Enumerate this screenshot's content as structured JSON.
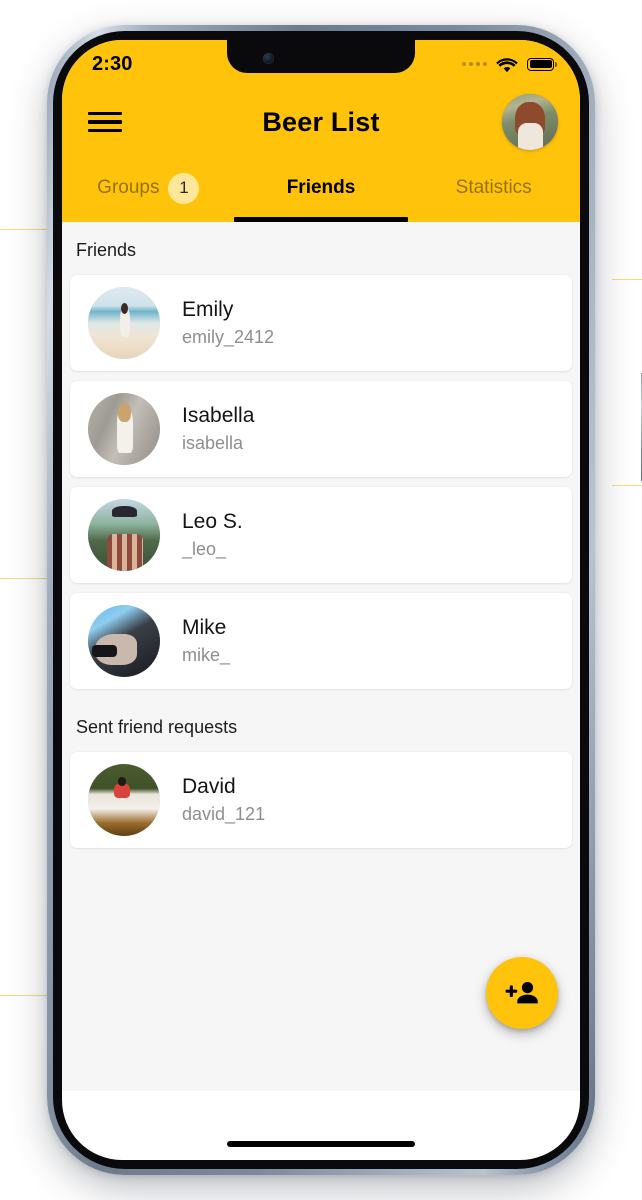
{
  "status_bar": {
    "time": "2:30",
    "cellular_icon": "cellular-dots-icon",
    "wifi_icon": "wifi-icon",
    "battery_icon": "battery-full-icon"
  },
  "header": {
    "menu_icon": "hamburger-menu-icon",
    "title": "Beer List",
    "avatar_icon": "profile-avatar",
    "background_color": "#FFC30B"
  },
  "tabs": [
    {
      "label": "Groups",
      "badge": "1",
      "active": false
    },
    {
      "label": "Friends",
      "badge": "",
      "active": true
    },
    {
      "label": "Statistics",
      "badge": "",
      "active": false
    }
  ],
  "sections": [
    {
      "title": "Friends",
      "items": [
        {
          "name": "Emily",
          "handle": "emily_2412",
          "avatar": "emily-avatar"
        },
        {
          "name": "Isabella",
          "handle": "isabella",
          "avatar": "isabella-avatar"
        },
        {
          "name": "Leo S.",
          "handle": "_leo_",
          "avatar": "leo-avatar"
        },
        {
          "name": "Mike",
          "handle": "mike_",
          "avatar": "mike-avatar"
        }
      ]
    },
    {
      "title": "Sent friend requests",
      "items": [
        {
          "name": "David",
          "handle": "david_121",
          "avatar": "david-avatar"
        }
      ]
    }
  ],
  "fab": {
    "icon": "person-add-icon",
    "color": "#FFC30B"
  },
  "colors": {
    "accent": "#FFC30B",
    "badge": "#FFE79A",
    "page_background": "#F6F6F6",
    "card_background": "#FFFFFF",
    "handle_text": "#8E8E8E",
    "inactive_tab_text": "rgba(0,0,0,0.42)"
  }
}
